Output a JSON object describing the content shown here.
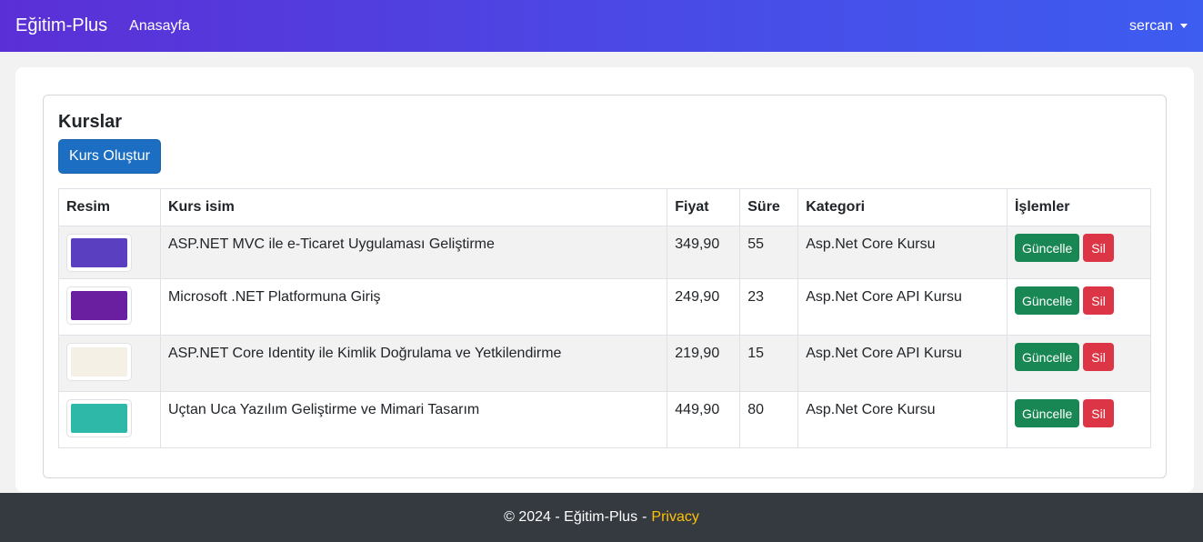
{
  "navbar": {
    "brand": "Eğitim-Plus",
    "home": "Anasayfa",
    "user": "sercan"
  },
  "main": {
    "title": "Kurslar",
    "create_label": "Kurs Oluştur",
    "columns": [
      "Resim",
      "Kurs isim",
      "Fiyat",
      "Süre",
      "Kategori",
      "İşlemler"
    ],
    "rows": [
      {
        "name": "ASP.NET MVC ile e-Ticaret Uygulaması Geliştirme",
        "price": "349,90",
        "duration": "55",
        "category": "Asp.Net Core Kursu",
        "thumb_color": "#5a3fc0"
      },
      {
        "name": "Microsoft .NET Platformuna Giriş",
        "price": "249,90",
        "duration": "23",
        "category": "Asp.Net Core API Kursu",
        "thumb_color": "#6a1fa0"
      },
      {
        "name": "ASP.NET Core Identity ile Kimlik Doğrulama ve Yetkilendirme",
        "price": "219,90",
        "duration": "15",
        "category": "Asp.Net Core API Kursu",
        "thumb_color": "#f5f0e6"
      },
      {
        "name": "Uçtan Uca Yazılım Geliştirme ve Mimari Tasarım",
        "price": "449,90",
        "duration": "80",
        "category": "Asp.Net Core Kursu",
        "thumb_color": "#2eb8a8"
      }
    ],
    "update_label": "Güncelle",
    "delete_label": "Sil"
  },
  "footer": {
    "copyright": "© 2024 - Eğitim-Plus",
    "separator": "-",
    "privacy": "Privacy"
  }
}
